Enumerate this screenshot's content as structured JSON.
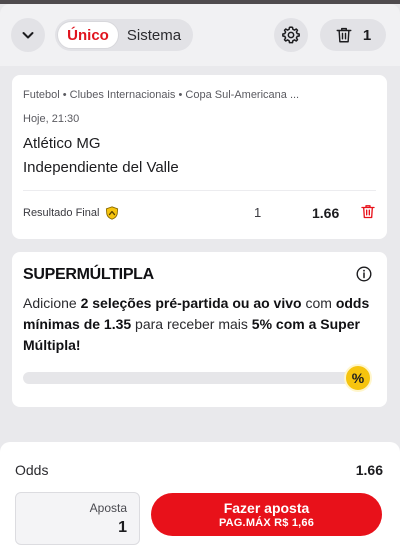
{
  "header": {
    "tabs": [
      {
        "label": "Único",
        "active": true
      },
      {
        "label": "Sistema",
        "active": false
      }
    ],
    "selection_count": "1",
    "icons": [
      "chevron-down-icon",
      "gear-icon",
      "trash-icon"
    ]
  },
  "selection": {
    "breadcrumb": "Futebol • Clubes Internacionais • Copa Sul-Americana ...",
    "time": "Hoje, 21:30",
    "home_team": "Atlético MG",
    "away_team": "Independiente del Valle",
    "market": "Resultado Final",
    "pick": "1",
    "odds": "1.66"
  },
  "promo": {
    "title": "SUPERMÚLTIPLA",
    "text_parts": [
      "Adicione ",
      "2 seleções pré-partida ou ao vivo",
      " com ",
      "odds mínimas de 1.35",
      " para receber mais ",
      "5% com a Super Múltipla!"
    ],
    "badge": "%",
    "progress_fraction": 0
  },
  "slip": {
    "odds_label": "Odds",
    "odds_value": "1.66",
    "stake_label": "Aposta",
    "stake_value": "1",
    "place_label": "Fazer aposta",
    "max_payout": "PAG.MÁX R$ 1,66"
  },
  "colors": {
    "accent": "#e8111a",
    "badge": "#f6c40e",
    "background": "#e9e9ec"
  }
}
